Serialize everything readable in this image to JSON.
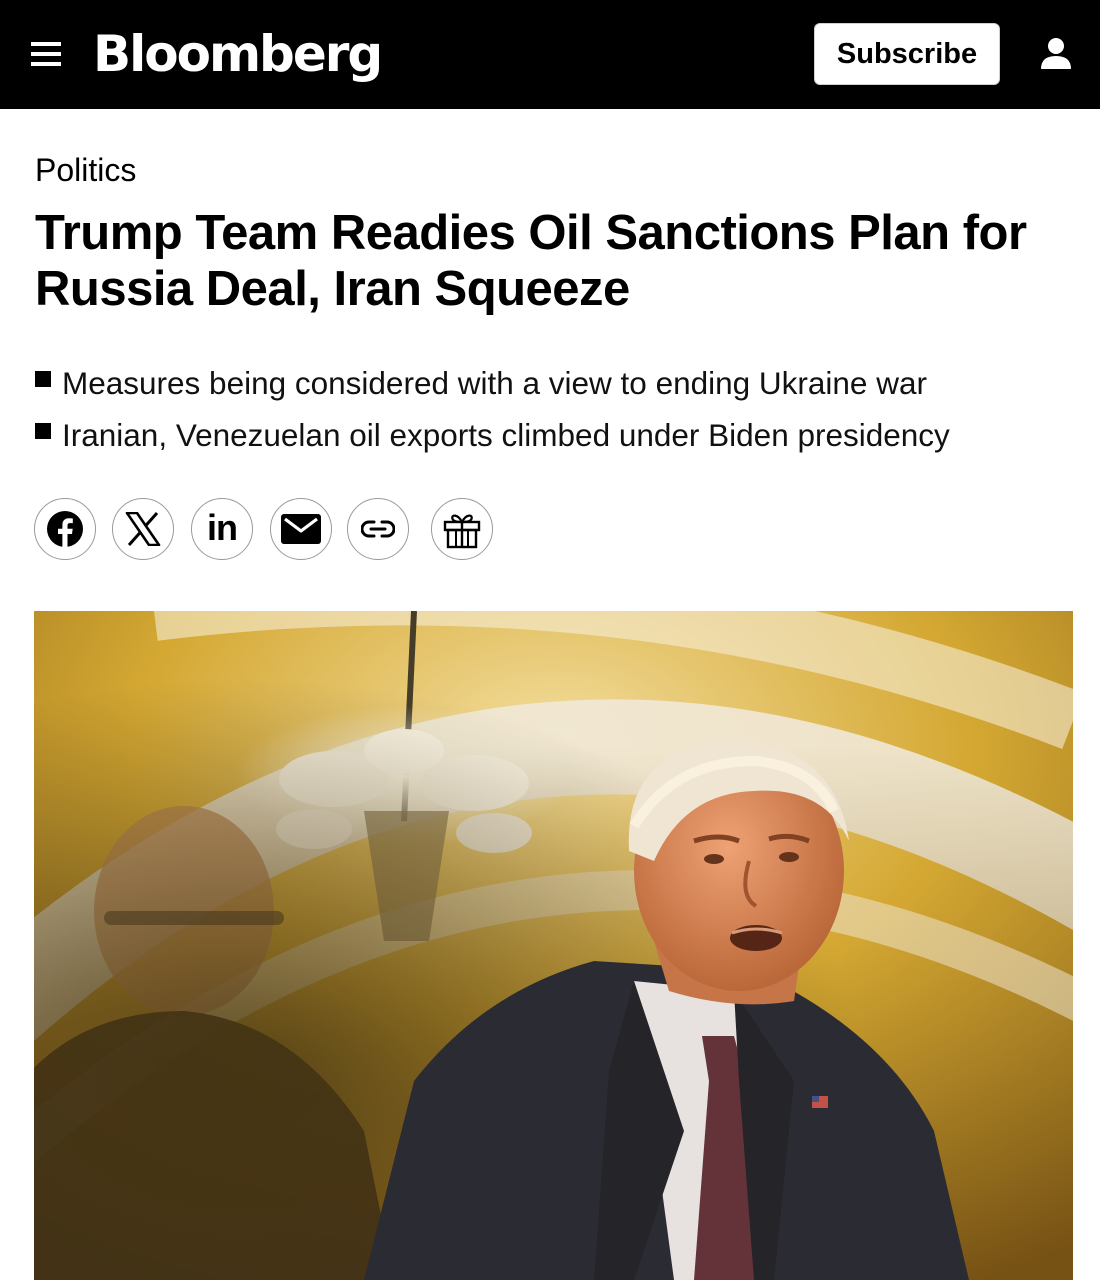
{
  "header": {
    "brand": "Bloomberg",
    "subscribe_label": "Subscribe"
  },
  "icons": {
    "menu": "hamburger-menu-icon",
    "user": "user-account-icon",
    "share": [
      "facebook-icon",
      "x-icon",
      "linkedin-icon",
      "email-icon",
      "link-icon",
      "gift-icon"
    ]
  },
  "article": {
    "category": "Politics",
    "headline": "Trump Team Readies Oil Sanctions Plan for Russia Deal, Iran Squeeze",
    "bullets": [
      "Measures being considered with a view to ending Ukraine war",
      "Iranian, Venezuelan oil exports climbed under Biden presidency"
    ],
    "share_labels": {
      "linkedin": "in"
    }
  },
  "colors": {
    "topbar": "#000000",
    "text": "#000000",
    "hero_background": "#c9a13a"
  }
}
